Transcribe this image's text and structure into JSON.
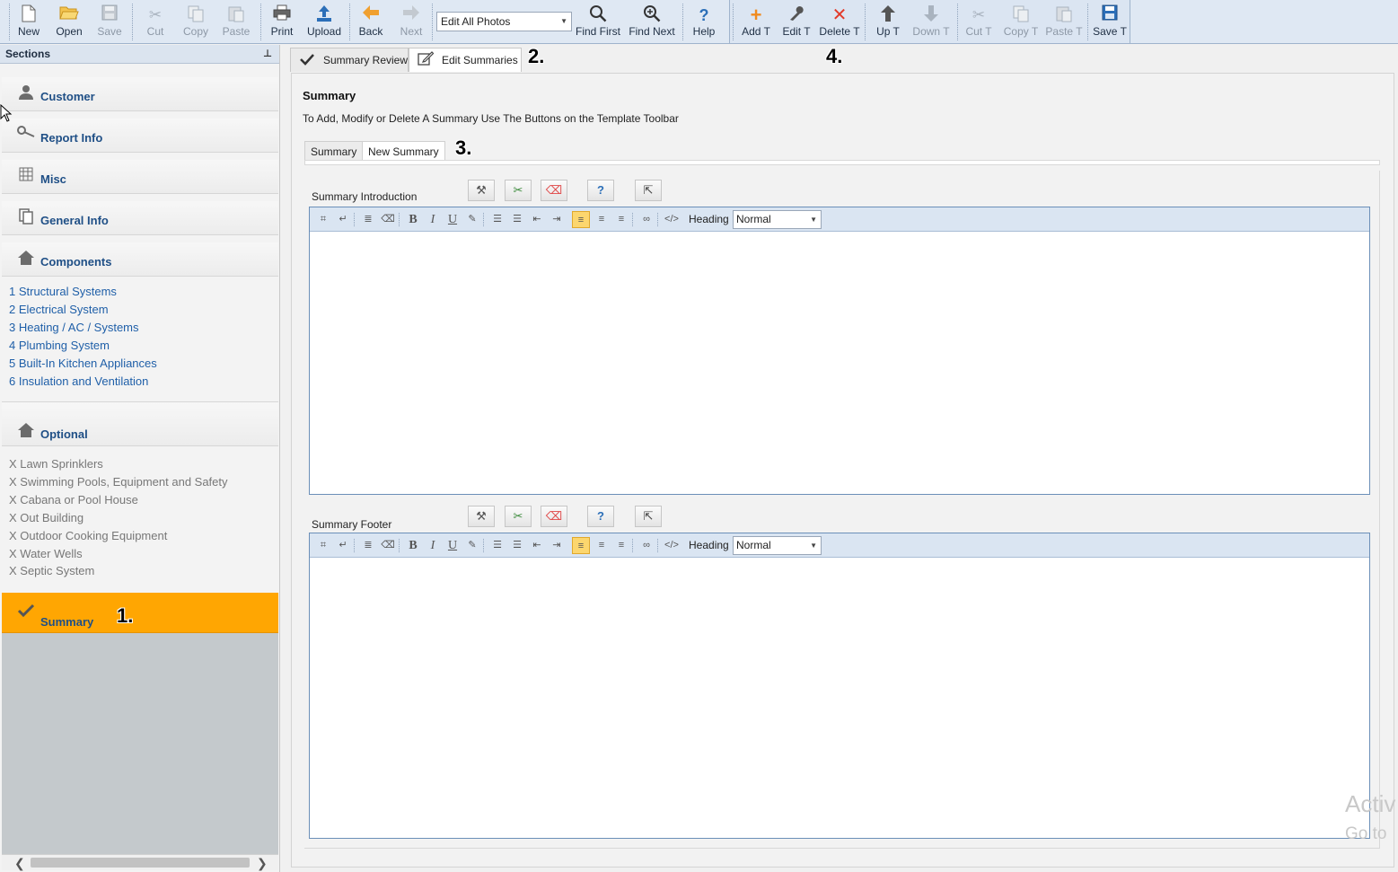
{
  "toolbar": {
    "new": "New",
    "open": "Open",
    "save": "Save",
    "cut": "Cut",
    "copy": "Copy",
    "paste": "Paste",
    "print": "Print",
    "upload": "Upload",
    "back": "Back",
    "next": "Next",
    "photo_select": "Edit All Photos",
    "find_first": "Find First",
    "find_next": "Find Next",
    "help": "Help",
    "add_t": "Add T",
    "edit_t": "Edit T",
    "delete_t": "Delete T",
    "up_t": "Up T",
    "down_t": "Down T",
    "cut_t": "Cut T",
    "copy_t": "Copy T",
    "paste_t": "Paste T",
    "save_t": "Save T"
  },
  "sidebar": {
    "title": "Sections",
    "sections": {
      "customer": "Customer",
      "report_info": "Report Info",
      "misc": "Misc",
      "general_info": "General Info",
      "components": "Components",
      "optional": "Optional",
      "summary": "Summary"
    },
    "components": [
      "1 Structural Systems",
      "2 Electrical System",
      "3 Heating / AC / Systems",
      "4 Plumbing System",
      "5 Built-In Kitchen Appliances",
      "6 Insulation and Ventilation"
    ],
    "optional": [
      "X Lawn Sprinklers",
      "X Swimming Pools, Equipment and Safety",
      "X Cabana or Pool House",
      "X Out Building",
      "X Outdoor Cooking Equipment",
      "X Water Wells",
      "X Septic System"
    ]
  },
  "markers": {
    "m1": "1.",
    "m2": "2.",
    "m3": "3.",
    "m4": "4."
  },
  "main": {
    "tabs": {
      "summary_review": "Summary Review",
      "edit_summaries": "Edit Summaries"
    },
    "title": "Summary",
    "instructions": "To Add, Modify or Delete A Summary Use The Buttons on the Template Toolbar",
    "inner_tabs": {
      "summary": "Summary",
      "new_summary": "New Summary"
    },
    "editors": {
      "intro_label": "Summary Introduction",
      "footer_label": "Summary Footer",
      "heading_label": "Heading",
      "heading_value": "Normal"
    }
  },
  "watermark": {
    "line1": "Activ",
    "line2": "Go to"
  },
  "colors": {
    "active_section": "#ffa602",
    "link": "#1f5fa8",
    "toolbar": "#dfe8f3"
  }
}
